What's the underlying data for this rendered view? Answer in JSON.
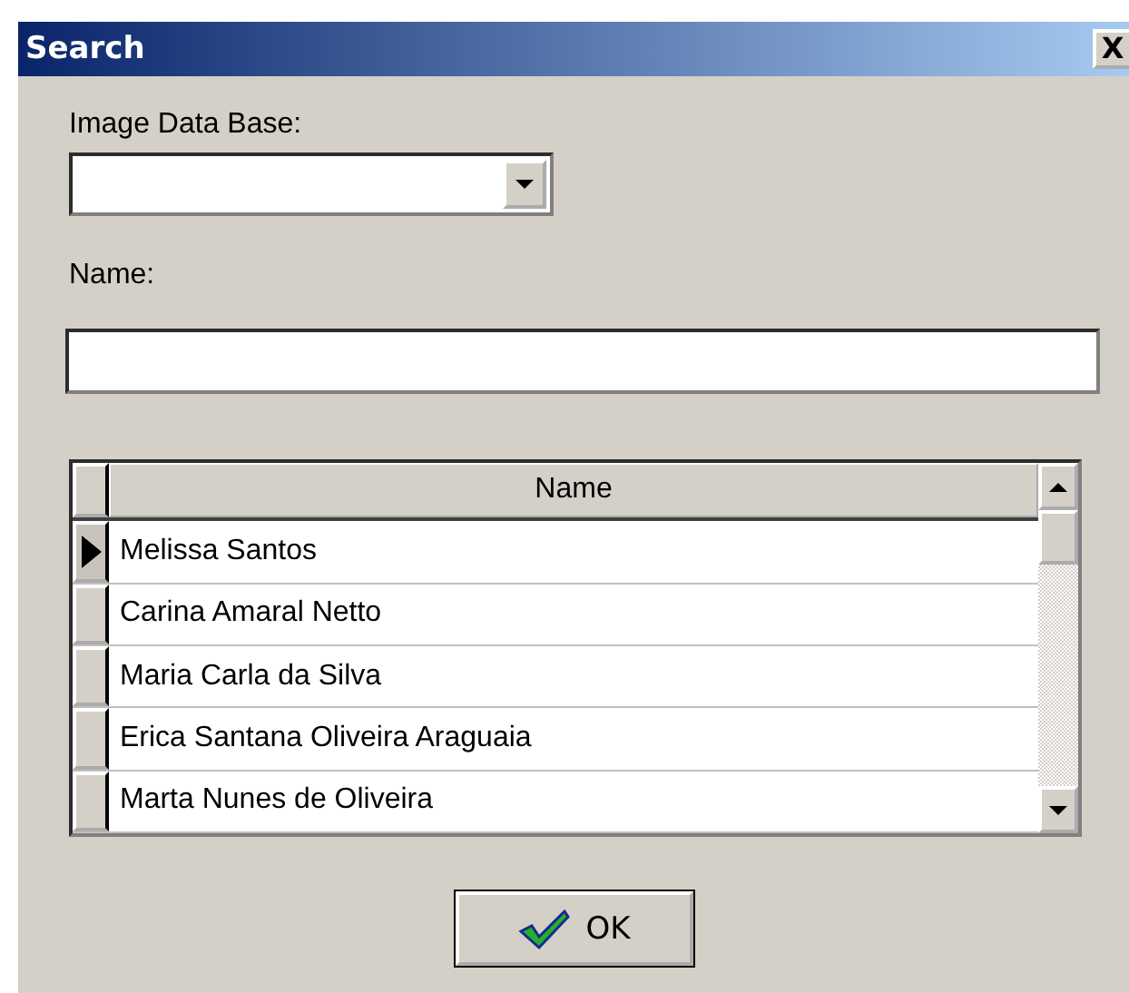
{
  "window": {
    "title": "Search",
    "close": "X"
  },
  "database": {
    "label": "Image Data Base:"
  },
  "name": {
    "label": "Name:"
  },
  "grid": {
    "columns": [
      "Name"
    ],
    "rows": [
      {
        "name": "Melissa Santos",
        "selected": true
      },
      {
        "name": "Carina Amaral Netto",
        "selected": false
      },
      {
        "name": "Maria Carla da Silva",
        "selected": false
      },
      {
        "name": "Erica Santana Oliveira Araguaia",
        "selected": false
      },
      {
        "name": "Marta Nunes de Oliveira",
        "selected": false
      }
    ]
  },
  "ok_button": {
    "label": "OK"
  }
}
